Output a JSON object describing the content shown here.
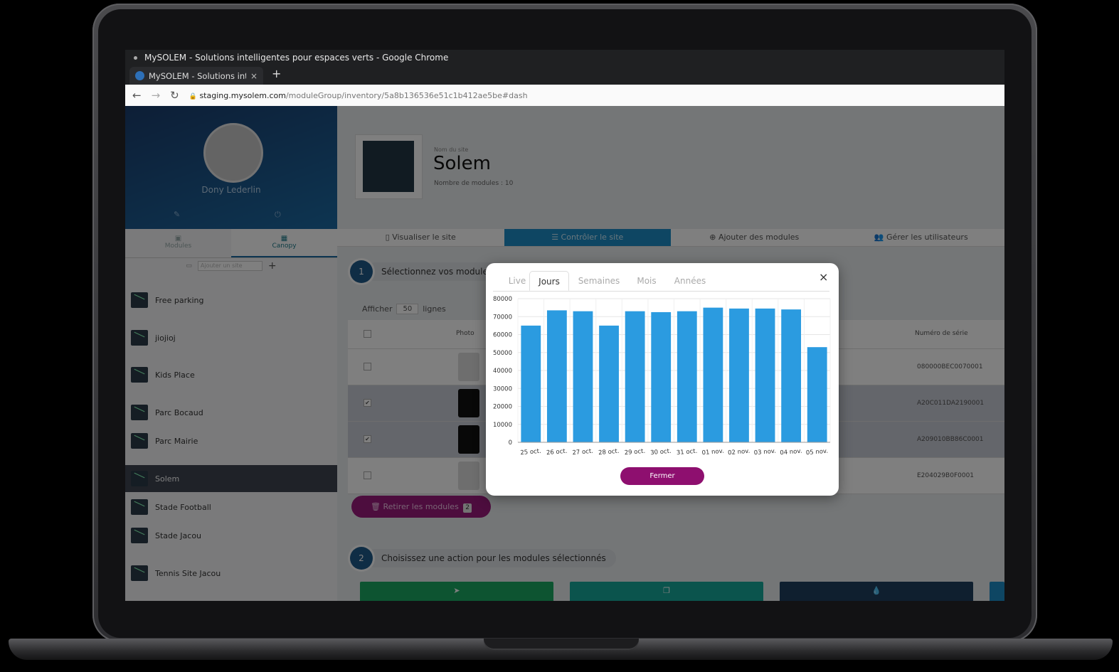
{
  "browser": {
    "window_title": "MySOLEM - Solutions intelligentes pour espaces verts - Google Chrome",
    "tab_label": "MySOLEM - Solutions inte",
    "tab_close": "×",
    "new_tab": "+",
    "url_domain": "staging.mysolem.com",
    "url_path": "/moduleGroup/inventory/5a8b136536e51c1b412ae5be#dash"
  },
  "sidebar": {
    "user_name": "Dony Lederlin",
    "tabs": [
      "Modules",
      "Canopy"
    ],
    "site_input_placeholder": "Ajouter un site",
    "add": "+",
    "sites": [
      "Free parking",
      "jiojioj",
      "Kids Place",
      "Parc Bocaud",
      "Parc Mairie",
      "Solem",
      "Stade Football",
      "Stade Jacou",
      "Tennis Site Jacou"
    ],
    "selected_site": "Solem"
  },
  "header": {
    "subtitle": "Nom du site",
    "title": "Solem",
    "module_count": "Nombre de modules : 10"
  },
  "nav_tabs": [
    "Visualiser le site",
    "Contrôler le site",
    "Ajouter des modules",
    "Gérer les utilisateurs"
  ],
  "step1": {
    "number": "1",
    "label": "Sélectionnez vos modules"
  },
  "table": {
    "show_label": "Afficher",
    "show_value": "50",
    "lines_label": "lignes",
    "col_photo": "Photo",
    "col_serial": "Numéro de série",
    "rows": [
      {
        "checked": "",
        "serial": "080000BEC0070001"
      },
      {
        "checked": "✔",
        "serial": "A20C011DA2190001"
      },
      {
        "checked": "✔",
        "serial": "A209010BB86C0001"
      },
      {
        "checked": "",
        "serial": "E204029B0F0001"
      }
    ],
    "remove_label": "Retirer les modules",
    "remove_count": "2"
  },
  "step2": {
    "number": "2",
    "label": "Choisissez une action pour les modules sélectionnés"
  },
  "colors": {
    "accent": "#1c8cc6",
    "bar": "#2b9be0",
    "button": "#8e0f6f"
  },
  "modal": {
    "tabs": [
      "Live",
      "Jours",
      "Semaines",
      "Mois",
      "Années"
    ],
    "active_tab": "Jours",
    "close": "×",
    "close_button": "Fermer"
  },
  "chart_data": {
    "type": "bar",
    "categories": [
      "25 oct.",
      "26 oct.",
      "27 oct.",
      "28 oct.",
      "29 oct.",
      "30 oct.",
      "31 oct.",
      "01 nov.",
      "02 nov.",
      "03 nov.",
      "04 nov.",
      "05 nov."
    ],
    "values": [
      65000,
      73500,
      73000,
      65000,
      73000,
      72500,
      73000,
      75000,
      74500,
      74500,
      74000,
      53000
    ],
    "ylim": [
      0,
      80000
    ],
    "yticks": [
      "0",
      "10000",
      "20000",
      "30000",
      "40000",
      "50000",
      "60000",
      "70000",
      "80000"
    ],
    "grid": true
  }
}
